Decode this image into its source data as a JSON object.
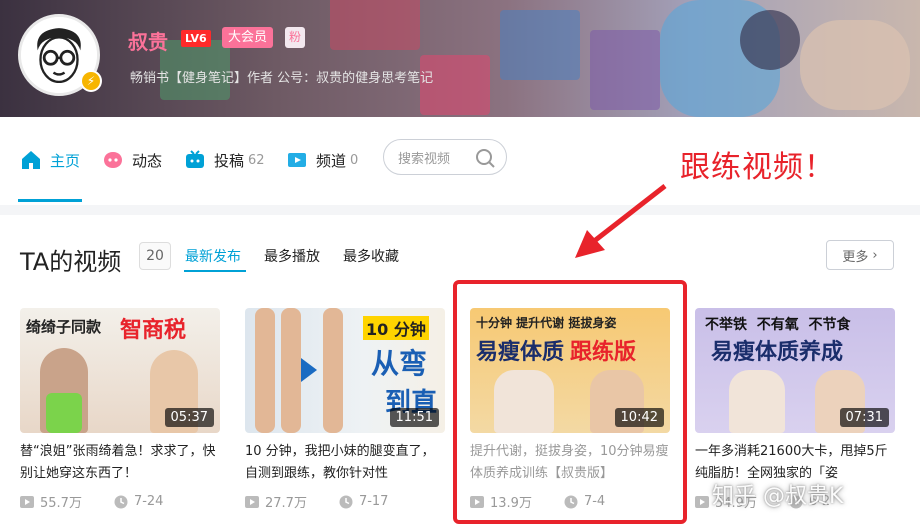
{
  "profile": {
    "name": "叔贵",
    "level": "LV6",
    "vip_label": "大会员",
    "fan_label": "粉",
    "signature": "畅销书【健身笔记】作者 公号：叔贵的健身思考笔记"
  },
  "nav": {
    "items": [
      {
        "label": "主页",
        "count": "",
        "icon": "home-icon"
      },
      {
        "label": "动态",
        "count": "",
        "icon": "dynamic-icon"
      },
      {
        "label": "投稿",
        "count": "62",
        "icon": "upload-icon"
      },
      {
        "label": "频道",
        "count": "0",
        "icon": "channel-icon"
      }
    ],
    "search_placeholder": "搜索视频"
  },
  "annotation": "跟练视频！",
  "section": {
    "title": "TA的视频",
    "count": "20",
    "sorts": [
      "最新发布",
      "最多播放",
      "最多收藏"
    ],
    "more": "更多"
  },
  "videos": [
    {
      "thumb_line1": "绮绮子同款",
      "thumb_line2": "智商税",
      "duration": "05:37",
      "title": "替“浪姐”张雨绮着急！求求了，快别让她穿这东西了！",
      "views": "55.7万",
      "date": "7-24"
    },
    {
      "thumb_line1": "10 分钟",
      "thumb_line2": "从弯",
      "thumb_line3": "到直",
      "duration": "11:51",
      "title": "10 分钟，我把小妹的腿变直了，自测到跟练，教你针对性",
      "views": "27.7万",
      "date": "7-17"
    },
    {
      "thumb_line1": "十分钟 提升代谢 挺拔身姿",
      "thumb_line2": "易瘦体质",
      "thumb_line3": "跟练版",
      "duration": "10:42",
      "title": "提升代谢，挺拔身姿，10分钟易瘦体质养成训练【叔贵版】",
      "views": "13.9万",
      "date": "7-4"
    },
    {
      "thumb_line1": "不举铁  不有氧  不节食",
      "thumb_line2": "易瘦体质养成",
      "duration": "07:31",
      "title": "一年多消耗21600大卡，甩掉5斤纯脂肪！全网独家的「姿",
      "views": "54.9万",
      "date": "6-2"
    }
  ],
  "watermark": "知乎 @叔贵K",
  "colors": {
    "accent": "#00a1d6",
    "pink": "#fb7299",
    "annotation_red": "#e8232b"
  }
}
